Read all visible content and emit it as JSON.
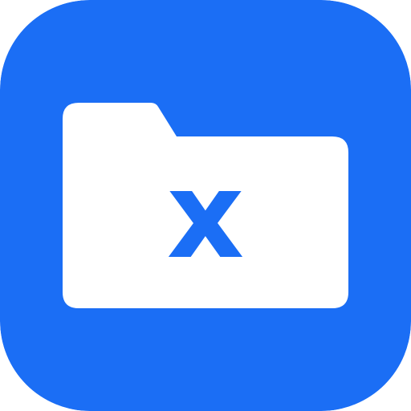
{
  "icon": {
    "name": "folder-x-app-icon",
    "symbol": "folder-icon",
    "letter": "x",
    "colors": {
      "background": "#1B6EF5",
      "folder": "#FFFFFF",
      "letter": "#1B6EF5"
    }
  }
}
